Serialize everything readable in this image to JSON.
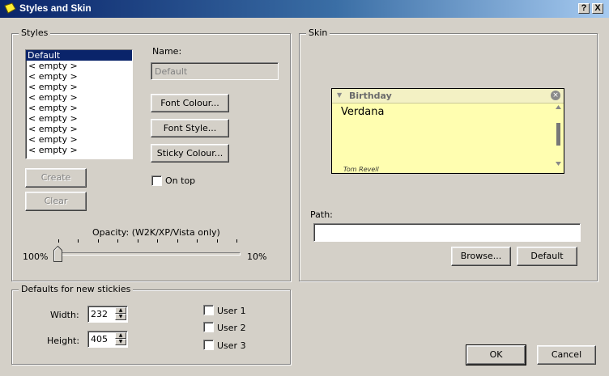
{
  "window": {
    "title": "Styles and Skin",
    "help_glyph": "?",
    "close_glyph": "X"
  },
  "styles": {
    "group_title": "Styles",
    "items": [
      "Default",
      "< empty >",
      "< empty >",
      "< empty >",
      "< empty >",
      "< empty >",
      "< empty >",
      "< empty >",
      "< empty >",
      "< empty >"
    ],
    "selected_index": 0,
    "name_label": "Name:",
    "name_placeholder": "Default",
    "font_colour": "Font Colour...",
    "font_style": "Font Style...",
    "sticky_colour": "Sticky Colour...",
    "create": "Create",
    "clear": "Clear",
    "on_top": "On top",
    "opacity_label": "Opacity:  (W2K/XP/Vista only)",
    "opacity_min": "100%",
    "opacity_max": "10%",
    "opacity_value": "100%"
  },
  "skin": {
    "group_title": "Skin",
    "preview": {
      "title": "Birthday",
      "body": "Verdana",
      "signature": "Tom Revell",
      "color": "#fffeb0"
    },
    "path_label": "Path:",
    "path_value": "",
    "browse": "Browse...",
    "default": "Default"
  },
  "defaults": {
    "group_title": "Defaults for new stickies",
    "width_label": "Width:",
    "width_value": "232",
    "height_label": "Height:",
    "height_value": "405",
    "user1": "User 1",
    "user2": "User 2",
    "user3": "User 3"
  },
  "footer": {
    "ok": "OK",
    "cancel": "Cancel"
  },
  "colors": {
    "titlebar": "#0a246a",
    "selection": "#0a246a",
    "face": "#d4d0c8"
  }
}
